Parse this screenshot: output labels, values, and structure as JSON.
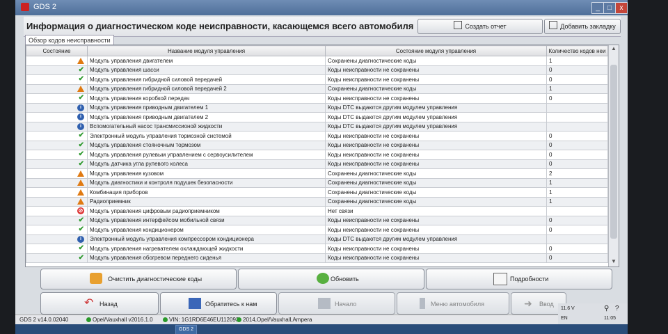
{
  "window": {
    "title": "GDS 2",
    "minimize": "_",
    "maximize": "□",
    "close": "x"
  },
  "header": {
    "title": "Информация о диагностическом коде неисправности, касающемся всего автомобиля",
    "create_report": "Создать отчет",
    "add_bookmark": "Добавить закладку"
  },
  "subtab": "Обзор кодов неисправности",
  "table": {
    "columns": [
      "Состояние",
      "Название модуля управления",
      "Состояние модуля управления",
      "Количество кодов неи"
    ],
    "rows": [
      {
        "icon": "warning",
        "name": "Модуль управления двигателем",
        "state": "Сохранены диагностические коды",
        "count": "1"
      },
      {
        "icon": "ok",
        "name": "Модуль управления шасси",
        "state": "Коды неисправности не сохранены",
        "count": "0"
      },
      {
        "icon": "ok",
        "name": "Модуль управления гибридной силовой передачей",
        "state": "Коды неисправности не сохранены",
        "count": "0"
      },
      {
        "icon": "warning",
        "name": "Модуль управления гибридной силовой передачей 2",
        "state": "Сохранены диагностические коды",
        "count": "1"
      },
      {
        "icon": "ok",
        "name": "Модуль управления коробкой передач",
        "state": "Коды неисправности не сохранены",
        "count": "0"
      },
      {
        "icon": "info",
        "name": "Модуль управления приводным двигателем 1",
        "state": "Коды DTC выдаются другим модулем управления",
        "count": ""
      },
      {
        "icon": "info",
        "name": "Модуль управления приводным двигателем 2",
        "state": "Коды DTC выдаются другим модулем управления",
        "count": ""
      },
      {
        "icon": "info",
        "name": "Вспомогательный насос трансмиссионой жидкости",
        "state": "Коды DTC выдаются другим модулем управления",
        "count": ""
      },
      {
        "icon": "ok",
        "name": "Электронный модуль управления тормозной системой",
        "state": "Коды неисправности не сохранены",
        "count": "0"
      },
      {
        "icon": "ok",
        "name": "Модуль управления стояночным тормозом",
        "state": "Коды неисправности не сохранены",
        "count": "0"
      },
      {
        "icon": "ok",
        "name": "Модуль управления рулевым управлением с сервоусилителем",
        "state": "Коды неисправности не сохранены",
        "count": "0"
      },
      {
        "icon": "ok",
        "name": "Модуль датчика угла рулевого колеса",
        "state": "Коды неисправности не сохранены",
        "count": "0"
      },
      {
        "icon": "warning",
        "name": "Модуль управления кузовом",
        "state": "Сохранены диагностические коды",
        "count": "2"
      },
      {
        "icon": "warning",
        "name": "Модуль диагностики и контроля подушек безопасности",
        "state": "Сохранены диагностические коды",
        "count": "1"
      },
      {
        "icon": "warning",
        "name": "Комбинация приборов",
        "state": "Сохранены диагностические коды",
        "count": "1"
      },
      {
        "icon": "warning",
        "name": "Радиоприемник",
        "state": "Сохранены диагностические коды",
        "count": "1"
      },
      {
        "icon": "error",
        "name": "Модуль управления цифровым радиоприемником",
        "state": "Нет связи",
        "count": ""
      },
      {
        "icon": "ok",
        "name": "Модуль управления интерфейсом мобильной связи",
        "state": "Коды неисправности не сохранены",
        "count": "0"
      },
      {
        "icon": "ok",
        "name": "Модуль управления кондиционером",
        "state": "Коды неисправности не сохранены",
        "count": "0"
      },
      {
        "icon": "info",
        "name": "Электронный модуль управления компрессором кондиционера",
        "state": "Коды DTC выдаются другим модулем управления",
        "count": ""
      },
      {
        "icon": "ok",
        "name": "Модуль управления нагревателем охлаждающей жидкости",
        "state": "Коды неисправности не сохранены",
        "count": "0"
      },
      {
        "icon": "ok",
        "name": "Модуль управления обогревом переднего сиденья",
        "state": "Коды неисправности не сохранены",
        "count": "0"
      }
    ]
  },
  "actions": {
    "clear_codes": "Очистить диагностические коды",
    "refresh": "Обновить",
    "details": "Подробности"
  },
  "nav": {
    "back": "Назад",
    "contact": "Обратитесь к нам",
    "home": "Начало",
    "vehicle_menu": "Меню автомобиля",
    "enter": "Ввод"
  },
  "status": {
    "version": "GDS 2 v14.0.02040",
    "brand": "Opel/Vauxhall v2016.1.0",
    "vin": "VIN: 1G1RD6E46EU112093",
    "vehicle": "2014,Opel/Vauxhall,Ampera"
  },
  "tray": {
    "lang": "EN",
    "voltage": "11.6 V",
    "time": "11:05"
  },
  "taskbar": [
    "GDS 2"
  ]
}
